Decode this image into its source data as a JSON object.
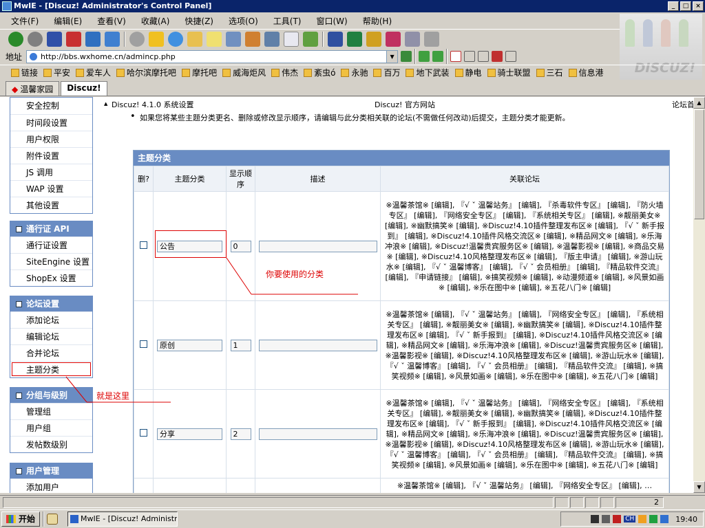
{
  "window": {
    "title": "MwIE - [Discuz! Administrator's Control Panel]",
    "buttons": [
      "_",
      "□",
      "×"
    ]
  },
  "menu": [
    "文件(F)",
    "编辑(E)",
    "查看(V)",
    "收藏(A)",
    "快捷(Z)",
    "选项(O)",
    "工具(T)",
    "窗口(W)",
    "帮助(H)"
  ],
  "address": {
    "label": "地址",
    "url": "http://bbs.wxhome.cn/admincp.php"
  },
  "links": [
    "链接",
    "平安",
    "爱车人",
    "哈尔滨摩托吧",
    "摩托吧",
    "威海炬风",
    "伟杰",
    "紊虫ó",
    "永驰",
    "百万",
    "地下武装",
    "静电",
    "骑士联盟",
    "三石",
    "信息港"
  ],
  "tabs": [
    {
      "label": "温馨家园",
      "active": false
    },
    {
      "label": "Discuz!",
      "active": true
    }
  ],
  "logo": {
    "text": "DISCUZ!"
  },
  "sidebar": {
    "top_items": [
      "安全控制",
      "时间段设置",
      "用户权限",
      "附件设置",
      "JS 调用",
      "WAP 设置",
      "其他设置"
    ],
    "groups": [
      {
        "title": "通行证 API",
        "items": [
          "通行证设置",
          "SiteEngine 设置",
          "ShopEx 设置"
        ]
      },
      {
        "title": "论坛设置",
        "items": [
          "添加论坛",
          "编辑论坛",
          "合并论坛",
          "主题分类"
        ]
      },
      {
        "title": "分组与级别",
        "items": [
          "管理组",
          "用户组",
          "发帖数级别"
        ]
      },
      {
        "title": "用户管理",
        "items": [
          "添加用户"
        ]
      }
    ]
  },
  "content": {
    "breadcrumb_left": "Discuz! 4.1.0 系统设置",
    "breadcrumb_center": "Discuz! 官方网站",
    "breadcrumb_right": "论坛首页",
    "note": "如果您将某些主题分类更名、删除或修改显示顺序，请编辑与此分类相关联的论坛(不需做任何改动)后提交，主题分类才能更新。",
    "panel_title": "主题分类",
    "columns": [
      "删?",
      "主题分类",
      "显示顺序",
      "描述",
      "关联论坛"
    ],
    "rows": [
      {
        "name": "公告",
        "order": "0",
        "desc": "",
        "forums": "※温馨茶馆※ [编辑], 『√ ˇ 温馨站务』 [编辑], 『杀毒软件专区』 [编辑], 『防火墙专区』 [编辑], 『网络安全专区』 [编辑], 『系统相关专区』 [编辑], ※靓丽美女※ [编辑], ※幽默搞笑※ [编辑], ※Discuz!4.10插件整理发布区※ [编辑], 『√ ˇ 新手报到』 [编辑], ※Discuz!4.10插件风格交流区※ [编辑], ※精品网文※ [编辑], ※乐海冲浪※ [编辑], ※Discuz!温馨贵宾服务区※ [编辑], ※温馨影视※ [编辑], ※商品交易※ [编辑], ※Discuz!4.10风格整理发布区※ [编辑], 『版主申请』 [编辑], ※游山玩水※ [编辑], 『√ ˇ 温馨博客』 [编辑], 『√ ˇ 会员相册』 [编辑], 『精品软件交流』 [编辑], 『申请链接』 [编辑], ※搞笑视频※ [编辑], ※动漫频道※ [编辑], ※风景如画※ [编辑], ※乐在图中※ [编辑], ※五花八门※ [编辑]"
      },
      {
        "name": "原创",
        "order": "1",
        "desc": "",
        "forums": "※温馨茶馆※ [编辑], 『√ ˇ 温馨站务』 [编辑], 『网络安全专区』 [编辑], 『系统相关专区』 [编辑], ※靓丽美女※ [编辑], ※幽默搞笑※ [编辑], ※Discuz!4.10插件整理发布区※ [编辑], 『√ ˇ 新手报到』 [编辑], ※Discuz!4.10插件风格交流区※ [编辑], ※精品网文※ [编辑], ※乐海冲浪※ [编辑], ※Discuz!温馨贵宾服务区※ [编辑], ※温馨影视※ [编辑], ※Discuz!4.10风格整理发布区※ [编辑], ※游山玩水※ [编辑], 『√ ˇ 温馨博客』 [编辑], 『√ ˇ 会员相册』 [编辑], 『精品软件交流』 [编辑], ※搞笑视频※ [编辑], ※风景如画※ [编辑], ※乐在图中※ [编辑], ※五花八门※ [编辑]"
      },
      {
        "name": "分享",
        "order": "2",
        "desc": "",
        "forums": "※温馨茶馆※ [编辑], 『√ ˇ 温馨站务』 [编辑], 『网络安全专区』 [编辑], 『系统相关专区』 [编辑], ※靓丽美女※ [编辑], ※幽默搞笑※ [编辑], ※Discuz!4.10插件整理发布区※ [编辑], 『√ ˇ 新手报到』 [编辑], ※Discuz!4.10插件风格交流区※ [编辑], ※精品网文※ [编辑], ※乐海冲浪※ [编辑], ※Discuz!温馨贵宾服务区※ [编辑], ※温馨影视※ [编辑], ※Discuz!4.10风格整理发布区※ [编辑], ※游山玩水※ [编辑], 『√ ˇ 温馨博客』 [编辑], 『√ ˇ 会员相册』 [编辑], 『精品软件交流』 [编辑], ※搞笑视频※ [编辑], ※风景如画※ [编辑], ※乐在图中※ [编辑], ※五花八门※ [编辑]"
      },
      {
        "name": "",
        "order": "",
        "desc": "",
        "forums": "※温馨茶馆※ [编辑], 『√ ˇ 温馨站务』 [编辑], 『网络安全专区』 [编辑], …"
      }
    ]
  },
  "annotations": {
    "category_note": "你要使用的分类",
    "sidebar_note": "就是这里"
  },
  "statusbar": {
    "page": "2"
  },
  "taskbar": {
    "start": "开始",
    "task": "MwIE - [Discuz! Administr...",
    "tray_ime": "CH",
    "clock": "19:40"
  },
  "colors": {
    "panel_header": "#698cc3",
    "title_bar": "#0a246a",
    "annotation": "#dd0000"
  }
}
